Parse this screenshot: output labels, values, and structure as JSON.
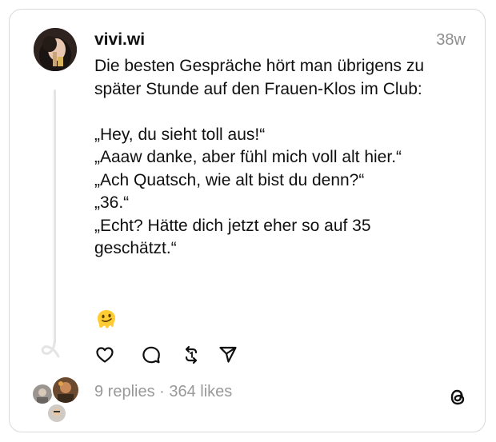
{
  "post": {
    "username": "vivi.wi",
    "timestamp": "38w",
    "body": "Die besten Gespräche hört man übrigens zu\nspäter Stunde auf den Frauen-Klos im Club:\n\n„Hey, du sieht toll aus!“\n„Aaaw danke, aber fühl mich voll alt hier.“\n„Ach Quatsch, wie alt bist du denn?“\n„36.“\n„Echt? Hätte dich jetzt eher so auf 35\ngeschätzt.“",
    "emoji": "melting-face-emoji"
  },
  "actions": {
    "icons": [
      "heart-icon",
      "comment-icon",
      "repost-icon",
      "share-icon"
    ]
  },
  "stats": {
    "text": "9 replies · 364 likes"
  },
  "colors": {
    "text": "#101010",
    "muted": "#999999",
    "border": "#d9d9d9",
    "thread_line": "#e4e4e4"
  }
}
